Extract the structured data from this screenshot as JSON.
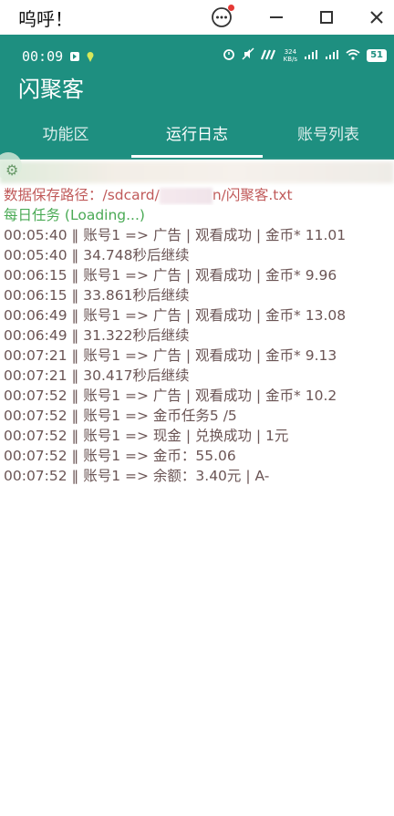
{
  "window": {
    "title": "呜呼！",
    "buttons": {
      "menu_icon": "ellipsis-circle-icon",
      "minimize_icon": "minimize-icon",
      "maximize_icon": "maximize-icon",
      "close_icon": "close-icon"
    }
  },
  "status_bar": {
    "time": "00:09",
    "net_speed_value": "324",
    "net_speed_unit": "KB/s",
    "battery": "51"
  },
  "app": {
    "title": "闪聚客",
    "header_color": "#1e8f80"
  },
  "tabs": [
    {
      "label": "功能区",
      "active": false
    },
    {
      "label": "运行日志",
      "active": true
    },
    {
      "label": "账号列表",
      "active": false
    }
  ],
  "log": {
    "path_prefix": "数据保存路径：/sdcard/",
    "path_suffix": "n/闪聚客.txt",
    "daily": "每日任务 (Loading...)",
    "lines": [
      "00:05:40 ‖ 账号1  =>  广告 | 观看成功 | 金币* 11.01",
      "00:05:40 ‖ 34.748秒后继续",
      "00:06:15 ‖ 账号1  =>  广告 | 观看成功 | 金币* 9.96",
      "00:06:15 ‖ 33.861秒后继续",
      "00:06:49 ‖ 账号1  =>  广告 | 观看成功 | 金币* 13.08",
      "00:06:49 ‖ 31.322秒后继续",
      "00:07:21 ‖ 账号1  =>  广告 | 观看成功 | 金币* 9.13",
      "00:07:21 ‖ 30.417秒后继续",
      "00:07:52 ‖ 账号1  =>  广告 | 观看成功 | 金币* 10.2",
      "00:07:52 ‖ 账号1  =>  金币任务5 /5",
      "00:07:52 ‖ 账号1  =>  现金 | 兑换成功 | 1元",
      "00:07:52 ‖ 账号1  =>  金币：55.06",
      "00:07:52 ‖ 账号1  =>  余额：3.40元 | A-"
    ]
  }
}
